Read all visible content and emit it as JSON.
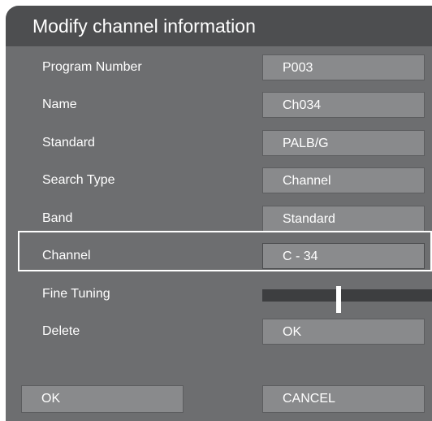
{
  "dialog": {
    "title": "Modify channel information"
  },
  "rows": [
    {
      "label": "Program Number",
      "value": "P003"
    },
    {
      "label": "Name",
      "value": "Ch034"
    },
    {
      "label": "Standard",
      "value": "PALB/G"
    },
    {
      "label": "Search Type",
      "value": "Channel"
    },
    {
      "label": "Band",
      "value": "Standard"
    },
    {
      "label": "Channel",
      "value": "C - 34"
    },
    {
      "label": "Fine Tuning",
      "level": 0.45
    },
    {
      "label": "Delete",
      "value": "OK"
    }
  ],
  "selected_row": "Channel",
  "footer": {
    "ok_label": "OK",
    "cancel_label": "CANCEL"
  },
  "colors": {
    "dialog_bg": "#6d6e70",
    "title_bg": "#4d4e50",
    "field_bg": "#898a8c",
    "slider_track": "#3d3e40",
    "text": "#ffffff",
    "highlight": "#ffffff"
  }
}
